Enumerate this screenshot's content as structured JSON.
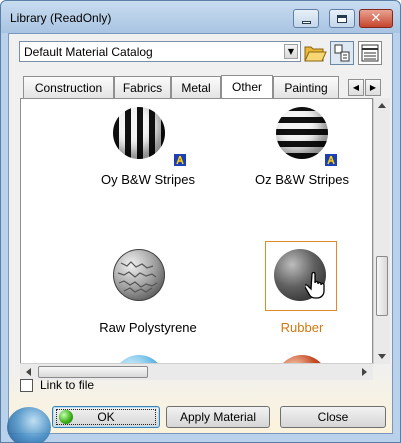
{
  "window": {
    "title": "Library (ReadOnly)"
  },
  "titlebar_buttons": {
    "minimize": "minimize-icon",
    "maximize": "maximize-icon",
    "close": "close-icon"
  },
  "catalog": {
    "selected": "Default Material Catalog"
  },
  "toolbar_icons": [
    "folder-open-icon",
    "list-view-icon",
    "grid-view-icon"
  ],
  "tabs": [
    {
      "label": "Construction",
      "active": false
    },
    {
      "label": "Fabrics",
      "active": false
    },
    {
      "label": "Metal",
      "active": false
    },
    {
      "label": "Other",
      "active": true
    },
    {
      "label": "Painting",
      "active": false
    }
  ],
  "materials": [
    {
      "name": "Oy B&W Stripes",
      "selected": false,
      "linked": true
    },
    {
      "name": "Oz B&W Stripes",
      "selected": false,
      "linked": true
    },
    {
      "name": "Raw Polystyrene",
      "selected": false,
      "linked": false
    },
    {
      "name": "Rubber",
      "selected": true,
      "linked": false
    }
  ],
  "options": {
    "link_to_file_label": "Link to file",
    "link_to_file_checked": false
  },
  "buttons": {
    "ok": "OK",
    "apply": "Apply Material",
    "close": "Close"
  },
  "colors": {
    "selected_text": "#d07a10",
    "selection_border": "#e08a28",
    "title_bar": "#b9d1ea",
    "close_button": "#c6452d"
  }
}
